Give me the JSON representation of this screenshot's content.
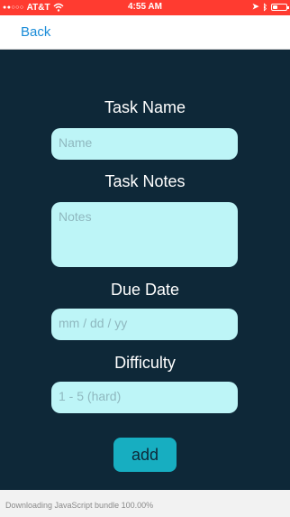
{
  "status_bar": {
    "carrier": "AT&T",
    "time": "4:55 AM",
    "battery_level": 0.3
  },
  "nav": {
    "back_label": "Back"
  },
  "form": {
    "task_name": {
      "label": "Task Name",
      "placeholder": "Name"
    },
    "task_notes": {
      "label": "Task Notes",
      "placeholder": "Notes"
    },
    "due_date": {
      "label": "Due Date",
      "placeholder": "mm / dd / yy"
    },
    "difficulty": {
      "label": "Difficulty",
      "placeholder": "1 - 5 (hard)"
    },
    "submit_label": "add"
  },
  "footer": {
    "bundle_status": "Downloading JavaScript bundle 100.00%"
  },
  "colors": {
    "status_bar": "#ff3b30",
    "form_background": "#0e2838",
    "input_background": "#bdf5f7",
    "button_background": "#17aec1",
    "link": "#1a8cd8"
  }
}
